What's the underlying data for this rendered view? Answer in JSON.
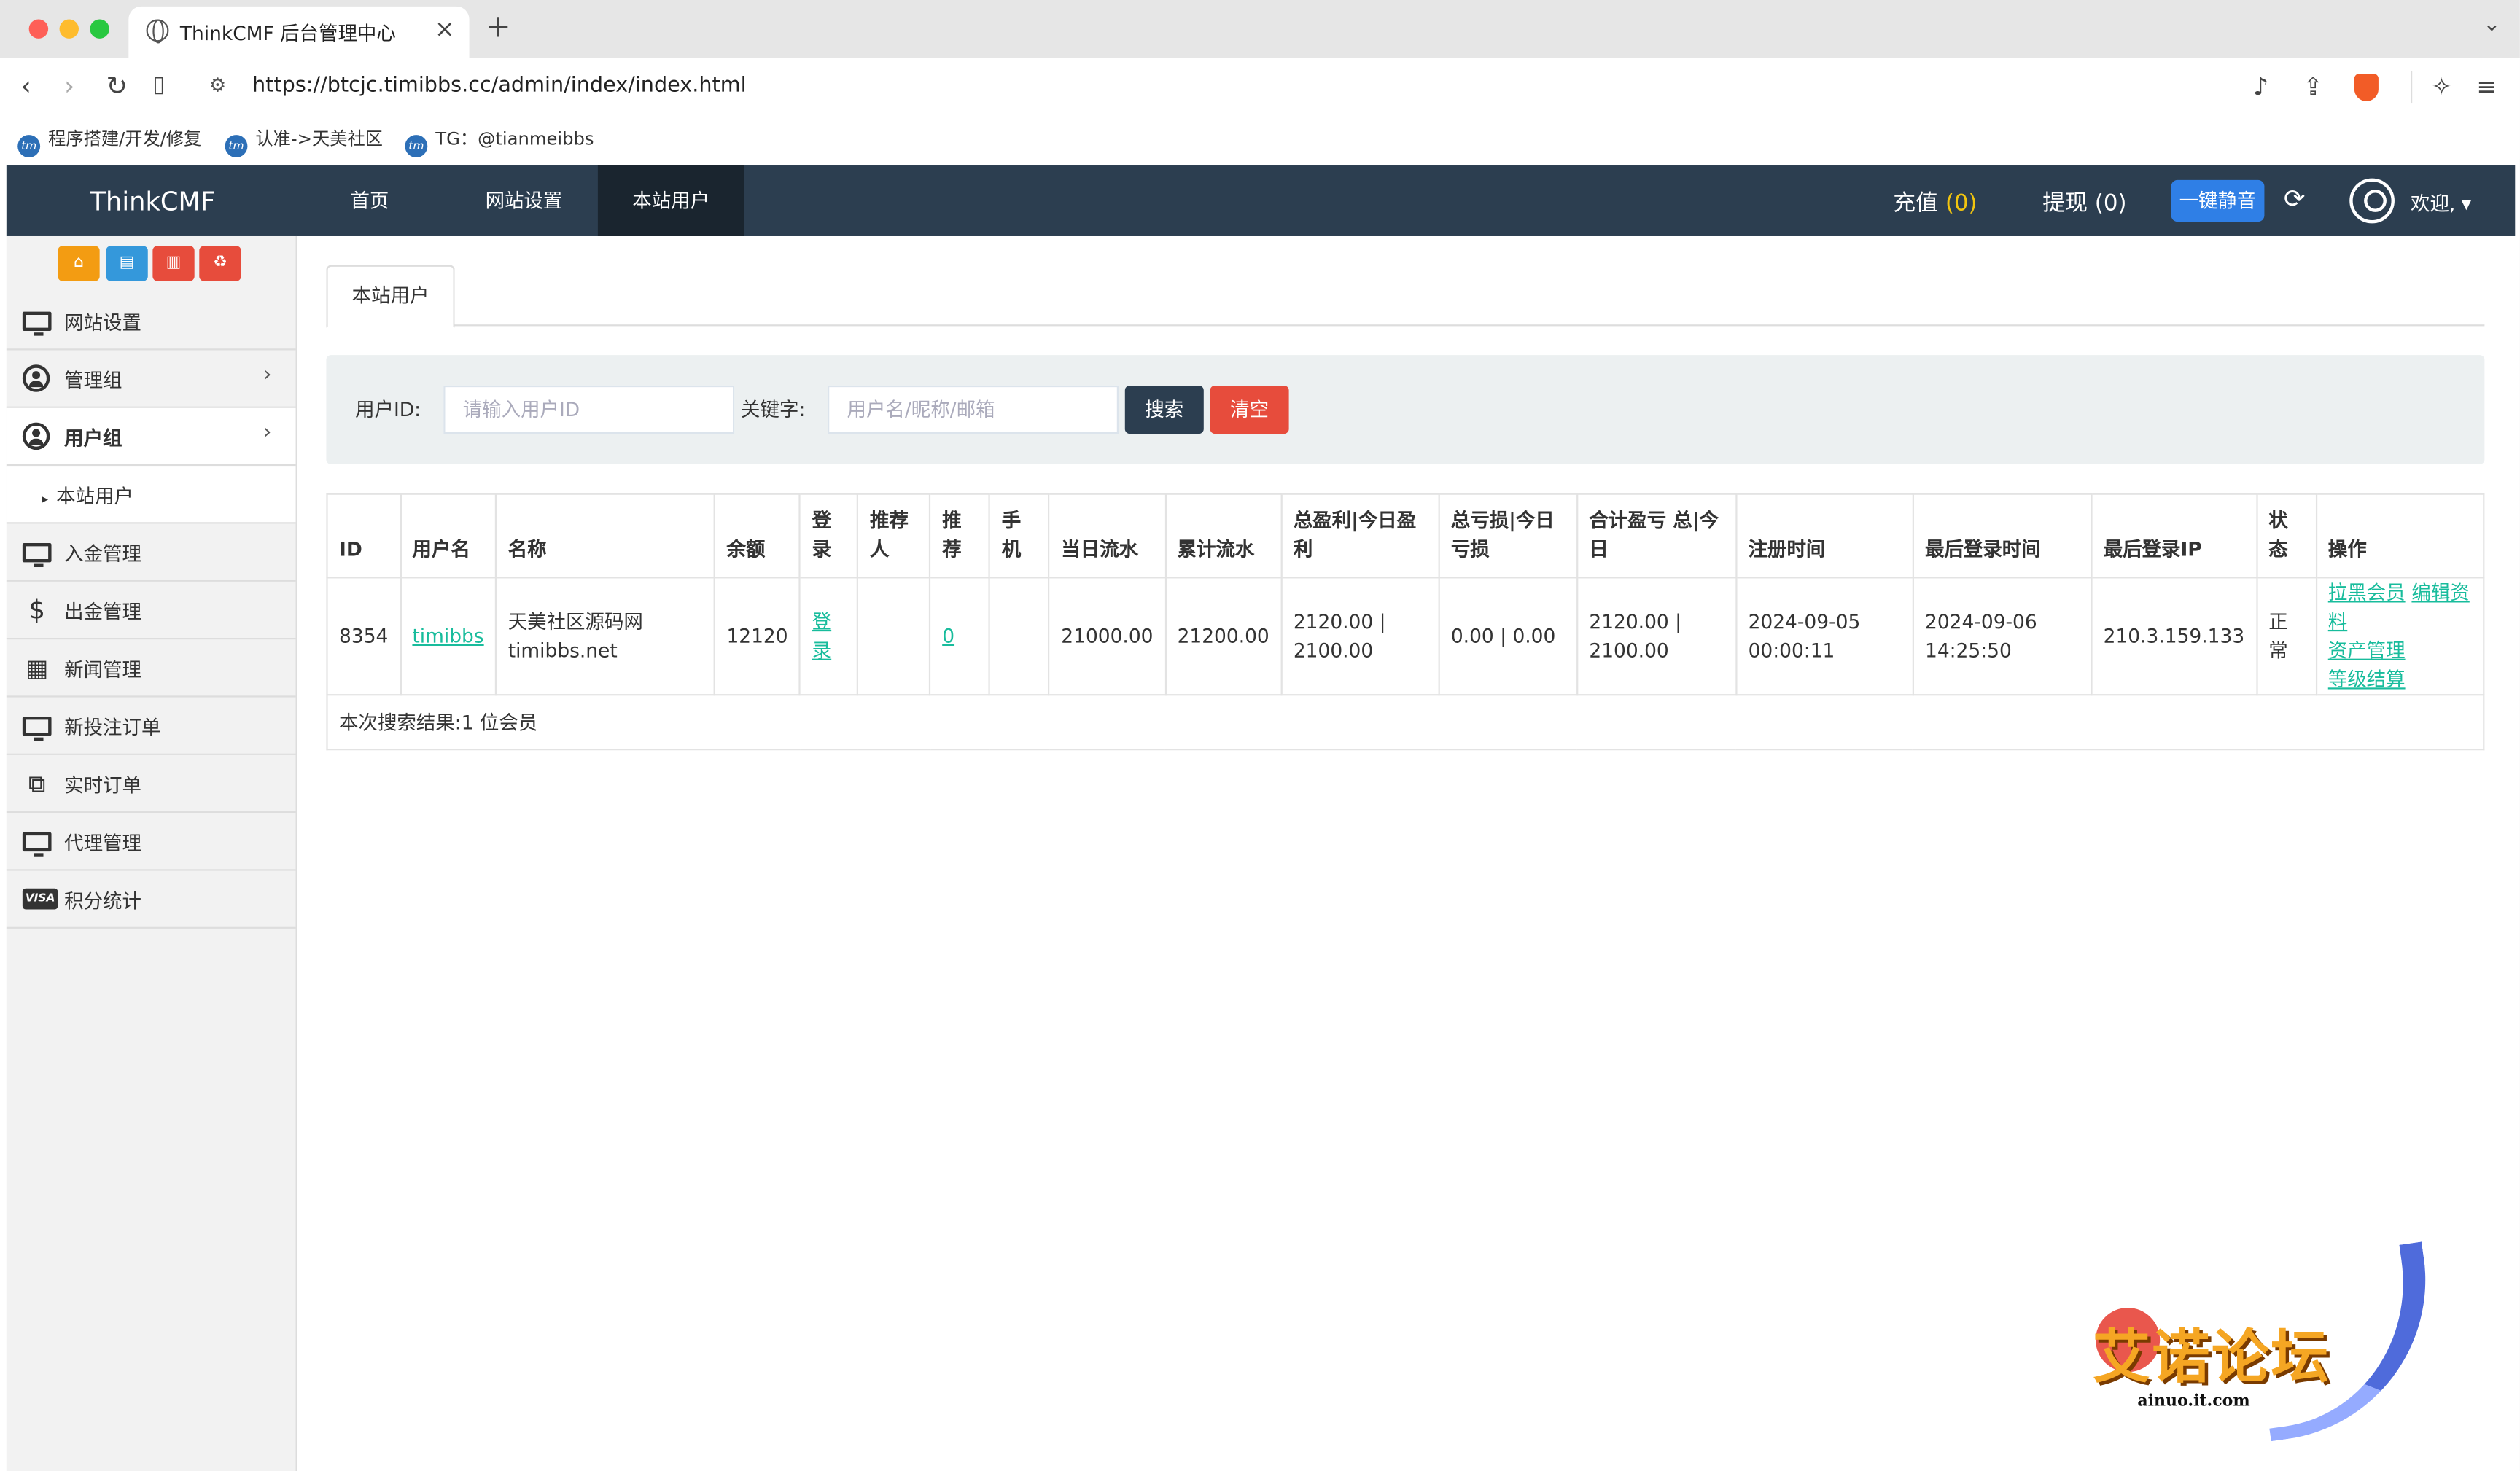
{
  "browser": {
    "tab_title": "ThinkCMF 后台管理中心",
    "url": "https://btcjc.timibbs.cc/admin/index/index.html",
    "bookmarks": [
      {
        "label": "程序搭建/开发/修复"
      },
      {
        "label": "认准->天美社区"
      },
      {
        "label": "TG：@tianmeibbs"
      }
    ]
  },
  "header": {
    "brand": "ThinkCMF",
    "nav": [
      {
        "label": "首页"
      },
      {
        "label": "网站设置"
      },
      {
        "label": "本站用户"
      }
    ],
    "recharge_label": "充值",
    "recharge_count": "(0)",
    "withdraw_label": "提现",
    "withdraw_count": "(0)",
    "mute_button": "一键静音",
    "welcome": "欢迎,"
  },
  "sidebar": {
    "quick_buttons": [
      {
        "icon": "home-icon",
        "color": "#f39c12"
      },
      {
        "icon": "file-icon",
        "color": "#3498db"
      },
      {
        "icon": "trash-icon",
        "color": "#e74c3c"
      },
      {
        "icon": "recycle-icon",
        "color": "#e74c3c"
      }
    ],
    "items": [
      {
        "label": "网站设置",
        "icon": "monitor-icon"
      },
      {
        "label": "管理组",
        "icon": "user-circle-icon"
      },
      {
        "label": "用户组",
        "icon": "user-circle-icon"
      },
      {
        "label": "本站用户"
      },
      {
        "label": "入金管理",
        "icon": "monitor-icon"
      },
      {
        "label": "出金管理",
        "icon": "dollar-icon"
      },
      {
        "label": "新闻管理",
        "icon": "newspaper-icon"
      },
      {
        "label": "新投注订单",
        "icon": "monitor-icon"
      },
      {
        "label": "实时订单",
        "icon": "windows-icon"
      },
      {
        "label": "代理管理",
        "icon": "monitor-icon"
      },
      {
        "label": "积分统计",
        "icon": "visa-icon"
      }
    ]
  },
  "content": {
    "tab_label": "本站用户",
    "search": {
      "user_id_label": "用户ID:",
      "user_id_placeholder": "请输入用户ID",
      "keyword_label": "关键字:",
      "keyword_placeholder": "用户名/昵称/邮箱",
      "search_button": "搜索",
      "clear_button": "清空"
    },
    "table": {
      "headers": [
        "ID",
        "用户名",
        "名称",
        "余额",
        "登录",
        "推荐人",
        "推荐",
        "手机",
        "当日流水",
        "累计流水",
        "总盈利|今日盈利",
        "总亏损|今日亏损",
        "合计盈亏 总|今日",
        "注册时间",
        "最后登录时间",
        "最后登录IP",
        "状态",
        "操作"
      ],
      "row": {
        "id": "8354",
        "username": "timibbs",
        "name": "天美社区源码网timibbs.net",
        "balance": "12120",
        "login": "登录",
        "referrer": "",
        "referrals": "0",
        "phone": "",
        "daily_flow": "21000.00",
        "total_flow": "21200.00",
        "profit": "2120.00 | 2100.00",
        "loss": "0.00 | 0.00",
        "net": "2120.00 | 2100.00",
        "register_time": "2024-09-05 00:00:11",
        "last_login_time": "2024-09-06 14:25:50",
        "last_login_ip": "210.3.159.133",
        "status": "正常",
        "actions": [
          "拉黑会员",
          "编辑资料",
          "资产管理",
          "等级结算"
        ]
      },
      "footer": "本次搜索结果:1 位会员"
    }
  },
  "watermark": {
    "title": "艾诺论坛",
    "subtitle": "ainuo.it.com"
  }
}
